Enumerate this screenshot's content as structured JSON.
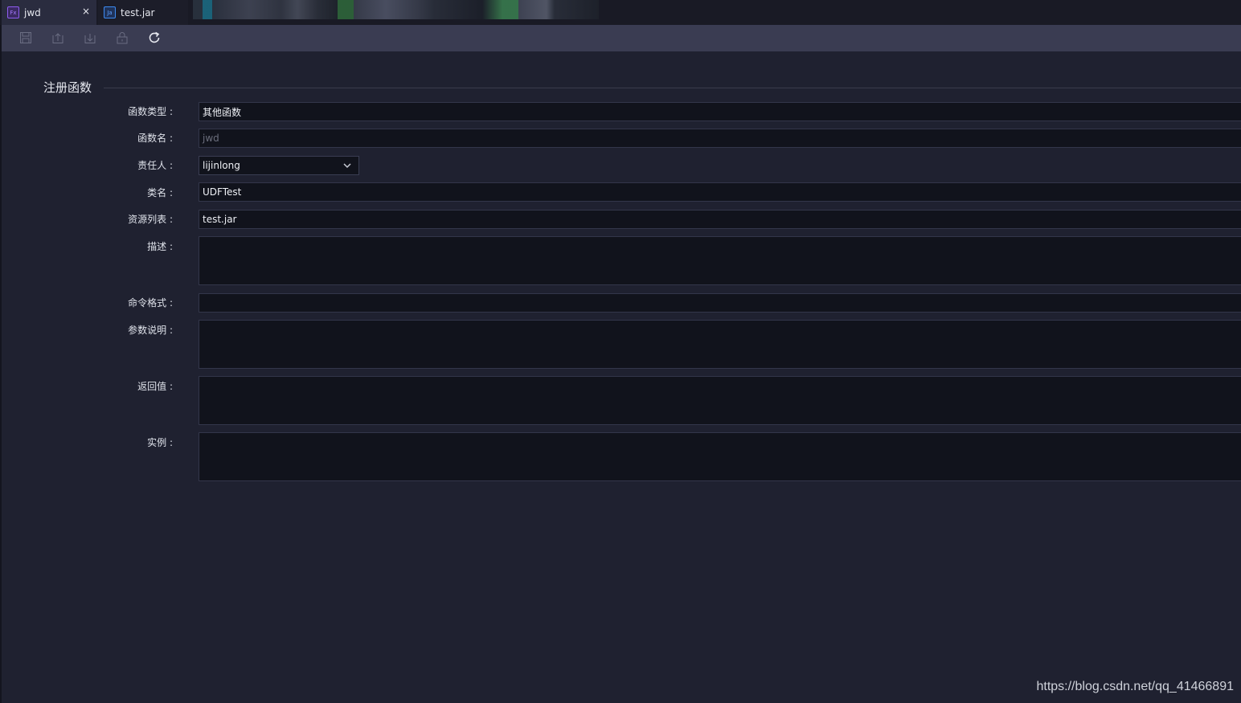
{
  "tabs": [
    {
      "icon": "function-file-icon",
      "badge": "Fx",
      "label": "jwd",
      "active": true,
      "close": "×"
    },
    {
      "icon": "jar-file-icon",
      "badge": "Ja",
      "label": "test.jar",
      "active": false
    }
  ],
  "toolbar": {
    "buttons": [
      "save-icon",
      "upload-icon",
      "download-icon",
      "lock-icon",
      "refresh-icon"
    ]
  },
  "section": {
    "title": "注册函数"
  },
  "form": {
    "function_type": {
      "label": "函数类型 :",
      "value": "其他函数"
    },
    "function_name": {
      "label": "函数名 :",
      "placeholder": "jwd"
    },
    "owner": {
      "label": "责任人 :",
      "value": "lijinlong"
    },
    "class_name": {
      "label": "类名 :",
      "value": "UDFTest"
    },
    "resource_list": {
      "label": "资源列表 :",
      "value": "test.jar"
    },
    "description": {
      "label": "描述 :",
      "value": ""
    },
    "command_format": {
      "label": "命令格式 :",
      "value": ""
    },
    "param_desc": {
      "label": "参数说明 :",
      "value": ""
    },
    "return_value": {
      "label": "返回值 :",
      "value": ""
    },
    "example": {
      "label": "实例 :",
      "value": ""
    }
  },
  "watermark": "https://blog.csdn.net/qq_41466891",
  "colors": {
    "background": "#1f2130",
    "toolbar": "#3a3c52",
    "input_bg": "#11131c",
    "fx_accent": "#8e5cf0",
    "jar_accent": "#3d8bf2"
  }
}
